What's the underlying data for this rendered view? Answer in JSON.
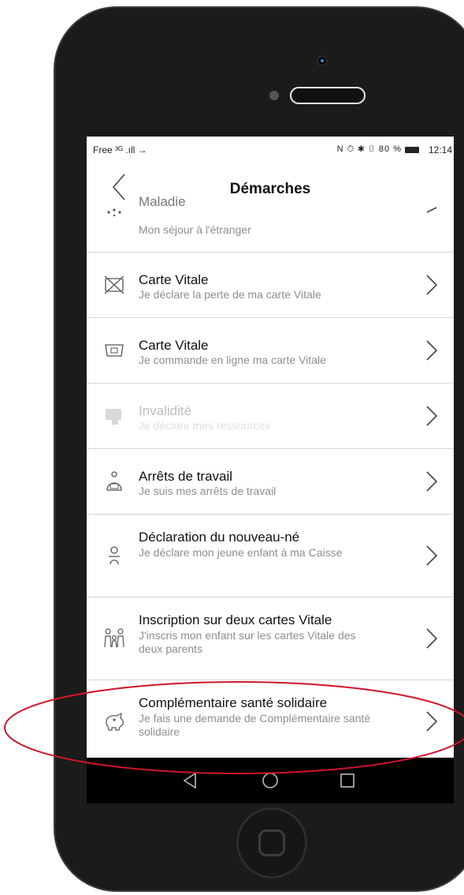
{
  "status_bar": {
    "carrier": "Free ³ᴳ .ıll →",
    "icons": "N ⏱ ✱ ▯ 80 %",
    "time": "12:14"
  },
  "header": {
    "title": "Démarches"
  },
  "items": [
    {
      "title": "Maladie",
      "subtitle": "Mon séjour à l'étranger",
      "icon": "globe-dots-icon"
    },
    {
      "title": "Carte Vitale",
      "subtitle": "Je déclare la perte de ma carte Vitale",
      "icon": "card-crossed-icon"
    },
    {
      "title": "Carte Vitale",
      "subtitle": "Je commande en ligne ma carte Vitale",
      "icon": "card-order-icon"
    },
    {
      "title": "Invalidité",
      "subtitle": "Je déclare mes ressources",
      "icon": "invalidity-icon"
    },
    {
      "title": "Arrêts de travail",
      "subtitle": "Je suis mes arrêts de travail",
      "icon": "sick-leave-icon"
    },
    {
      "title": "Déclaration du nouveau-né",
      "subtitle": "Je déclare mon jeune enfant à ma Caisse",
      "icon": "newborn-icon"
    },
    {
      "title": "Inscription sur deux cartes Vitale",
      "subtitle": "J'inscris mon enfant sur les cartes Vitale des deux parents",
      "icon": "family-icon"
    },
    {
      "title": "Complémentaire santé solidaire",
      "subtitle": "Je fais une demande de Complémentaire santé solidaire",
      "icon": "piggy-bank-icon"
    }
  ],
  "colors": {
    "highlight": "#d0142c",
    "separator": "#d7d7d7",
    "subtitle": "#8e8e8e"
  }
}
